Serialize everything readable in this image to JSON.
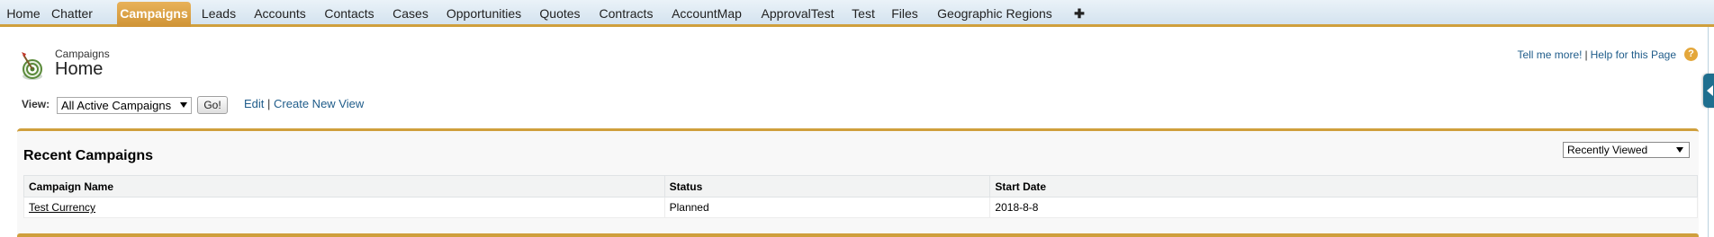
{
  "tabs": [
    {
      "label": "Home",
      "active": false
    },
    {
      "label": "Chatter",
      "active": false
    },
    {
      "label": "Campaigns",
      "active": true
    },
    {
      "label": "Leads",
      "active": false
    },
    {
      "label": "Accounts",
      "active": false
    },
    {
      "label": "Contacts",
      "active": false
    },
    {
      "label": "Cases",
      "active": false
    },
    {
      "label": "Opportunities",
      "active": false
    },
    {
      "label": "Quotes",
      "active": false
    },
    {
      "label": "Contracts",
      "active": false
    },
    {
      "label": "AccountMap",
      "active": false
    },
    {
      "label": "ApprovalTest",
      "active": false
    },
    {
      "label": "Test",
      "active": false
    },
    {
      "label": "Files",
      "active": false
    },
    {
      "label": "Geographic Regions",
      "active": false
    }
  ],
  "add_tab_icon": "plus-icon",
  "header": {
    "object_label": "Campaigns",
    "title": "Home",
    "icon": "campaign-target-icon"
  },
  "help": {
    "tell_more": "Tell me more!",
    "separator": "|",
    "help_page": "Help for this Page",
    "icon": "help-icon",
    "icon_glyph": "?"
  },
  "view": {
    "label": "View:",
    "selected": "All Active Campaigns",
    "go_label": "Go!",
    "edit_label": "Edit",
    "separator": "|",
    "create_label": "Create New View"
  },
  "recent": {
    "title": "Recent Campaigns",
    "filter_selected": "Recently Viewed",
    "columns": [
      "Campaign Name",
      "Status",
      "Start Date"
    ],
    "rows": [
      {
        "name": "Test Currency",
        "status": "Planned",
        "start_date": "2018-8-8"
      }
    ]
  },
  "colors": {
    "accent": "#cf9f3c",
    "active_tab": "#d89a3c",
    "link": "#1f5c8a",
    "tabbar": "#dbe7f0"
  }
}
